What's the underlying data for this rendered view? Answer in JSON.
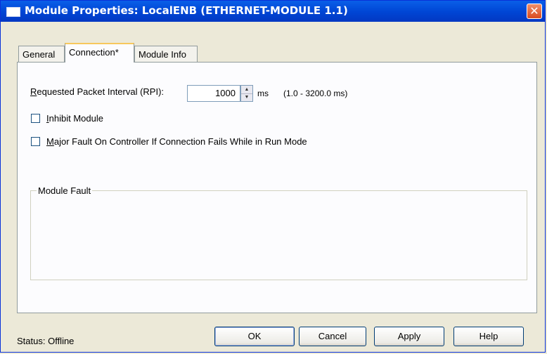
{
  "window": {
    "title": "Module Properties: LocalENB (ETHERNET-MODULE 1.1)",
    "close_icon": "close-icon",
    "accent_color": "#0A5FE8"
  },
  "tabs": [
    {
      "label": "General",
      "active": false
    },
    {
      "label": "Connection*",
      "active": true
    },
    {
      "label": "Module Info",
      "active": false
    }
  ],
  "connection": {
    "rpi_label_accel": "R",
    "rpi_label_rest": "equested Packet Interval (RPI):",
    "rpi_value": "1000",
    "rpi_unit": "ms",
    "rpi_range": "(1.0 - 3200.0 ms)",
    "inhibit_accel": "I",
    "inhibit_rest": "nhibit Module",
    "inhibit_checked": false,
    "major_fault_accel": "M",
    "major_fault_rest": "ajor Fault On Controller If Connection Fails While in Run Mode",
    "major_fault_checked": false,
    "module_fault_label": "Module Fault"
  },
  "status": {
    "text": "Status:  Offline"
  },
  "buttons": {
    "ok": "OK",
    "cancel": "Cancel",
    "apply": "Apply",
    "help": "Help"
  }
}
